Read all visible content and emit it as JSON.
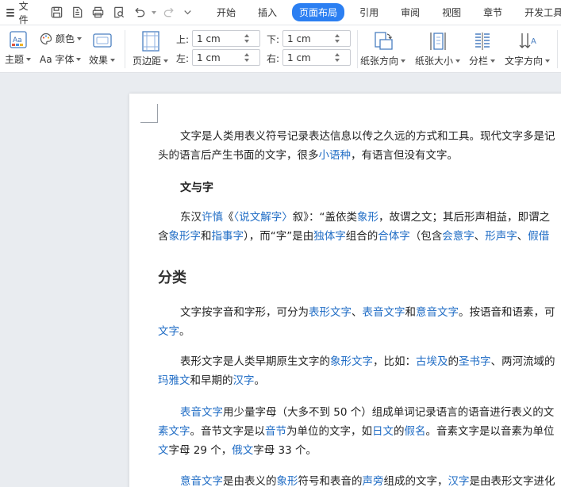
{
  "menubar": {
    "file_label": "文件",
    "tabs": [
      "开始",
      "插入",
      "页面布局",
      "引用",
      "审阅",
      "视图",
      "章节",
      "开发工具"
    ],
    "active_tab": "页面布局"
  },
  "ribbon": {
    "theme_label": "主题",
    "colors_label": "颜色",
    "font_label": "Aa 字体",
    "effects_label": "效果",
    "margins_label": "页边距",
    "margin_top_label": "上:",
    "margin_bottom_label": "下:",
    "margin_left_label": "左:",
    "margin_right_label": "右:",
    "margin_top_value": "1 cm",
    "margin_bottom_value": "1 cm",
    "margin_left_value": "1 cm",
    "margin_right_value": "1 cm",
    "orientation_label": "纸张方向",
    "size_label": "纸张大小",
    "columns_label": "分栏",
    "text_direction_label": "文字方向"
  },
  "colors": {
    "accent": "#2b7ff2",
    "link": "#1f6cc5"
  },
  "document": {
    "p1": [
      {
        "t": "文字是人类用表义符号记录表达信息以传之久远的方式和工具。现代文字多是记"
      },
      {
        "t": "头的语言后产生书面的文字，很多"
      },
      {
        "t": "小语种",
        "link": true
      },
      {
        "t": "，有语言但没有文字。"
      }
    ],
    "h_wenyuzi": "文与字",
    "p2": [
      {
        "t": "东汉"
      },
      {
        "t": "许慎",
        "link": true
      },
      {
        "t": "《"
      },
      {
        "t": "〈说文解字〉",
        "link": true
      },
      {
        "t": "叙》：“盖依类"
      },
      {
        "t": "象形",
        "link": true
      },
      {
        "t": "，故谓之文；其后形声相益，即谓之"
      },
      {
        "t": "含"
      },
      {
        "t": "象形字",
        "link": true
      },
      {
        "t": "和"
      },
      {
        "t": "指事字",
        "link": true
      },
      {
        "t": "），而“字”是由"
      },
      {
        "t": "独体字",
        "link": true
      },
      {
        "t": "组合的"
      },
      {
        "t": "合体字",
        "link": true
      },
      {
        "t": "（包含"
      },
      {
        "t": "会意字",
        "link": true
      },
      {
        "t": "、"
      },
      {
        "t": "形声字",
        "link": true
      },
      {
        "t": "、"
      },
      {
        "t": "假借",
        "link": true
      }
    ],
    "h_fenlei": "分类",
    "p3": [
      {
        "t": "文字按字音和字形，可分为"
      },
      {
        "t": "表形文字",
        "link": true
      },
      {
        "t": "、"
      },
      {
        "t": "表音文字",
        "link": true
      },
      {
        "t": "和"
      },
      {
        "t": "意音文字",
        "link": true
      },
      {
        "t": "。按语音和语素，可"
      },
      {
        "t": "文字",
        "link": true
      },
      {
        "t": "。"
      }
    ],
    "p4": [
      {
        "t": "表形文字是人类早期原生文字的"
      },
      {
        "t": "象形文字",
        "link": true
      },
      {
        "t": "，比如："
      },
      {
        "t": "古埃及",
        "link": true
      },
      {
        "t": "的"
      },
      {
        "t": "圣书字",
        "link": true
      },
      {
        "t": "、两河流域的"
      },
      {
        "t": "玛雅文",
        "link": true
      },
      {
        "t": "和早期的"
      },
      {
        "t": "汉字",
        "link": true
      },
      {
        "t": "。"
      }
    ],
    "p5": [
      {
        "t": "表音文字",
        "link": true
      },
      {
        "t": "用少量字母（大多不到 50 个）组成单词记录语言的语音进行表义的文"
      },
      {
        "t": "素文字",
        "link": true
      },
      {
        "t": "。音节文字是以"
      },
      {
        "t": "音节",
        "link": true
      },
      {
        "t": "为单位的文字，如"
      },
      {
        "t": "日文",
        "link": true
      },
      {
        "t": "的"
      },
      {
        "t": "假名",
        "link": true
      },
      {
        "t": "。音素文字是以音素为单位"
      },
      {
        "t": "文",
        "link": true
      },
      {
        "t": "字母 29 个，"
      },
      {
        "t": "俄文",
        "link": true
      },
      {
        "t": "字母 33 个。"
      }
    ],
    "p6": [
      {
        "t": "意音文字",
        "link": true
      },
      {
        "t": "是由表义的"
      },
      {
        "t": "象形",
        "link": true
      },
      {
        "t": "符号和表音的"
      },
      {
        "t": "声旁",
        "link": true
      },
      {
        "t": "组成的文字，"
      },
      {
        "t": "汉字",
        "link": true
      },
      {
        "t": "是由表形文字进化"
      }
    ]
  }
}
